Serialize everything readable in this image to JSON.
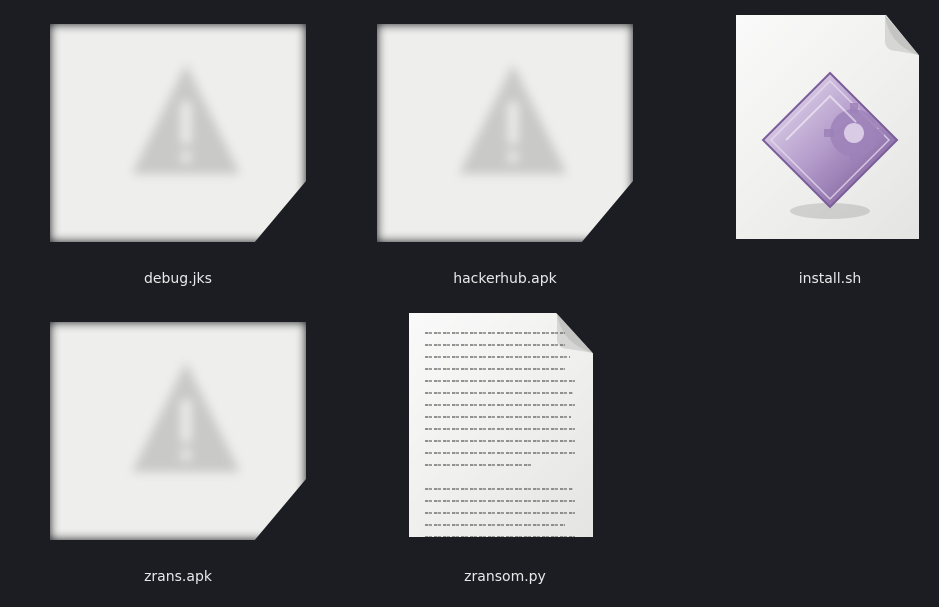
{
  "files": [
    {
      "name": "debug.jks",
      "type": "broken-thumbnail",
      "icon": "warning-icon"
    },
    {
      "name": "hackerhub.apk",
      "type": "broken-thumbnail",
      "icon": "warning-icon"
    },
    {
      "name": "install.sh",
      "type": "script",
      "icon": "executable-script-icon"
    },
    {
      "name": "zrans.apk",
      "type": "broken-thumbnail",
      "icon": "warning-icon"
    },
    {
      "name": "zransom.py",
      "type": "text",
      "icon": "text-document-icon"
    }
  ],
  "colors": {
    "background": "#1c1d22",
    "label": "#e8e8ea",
    "script_accent": "#8e6fb0"
  }
}
